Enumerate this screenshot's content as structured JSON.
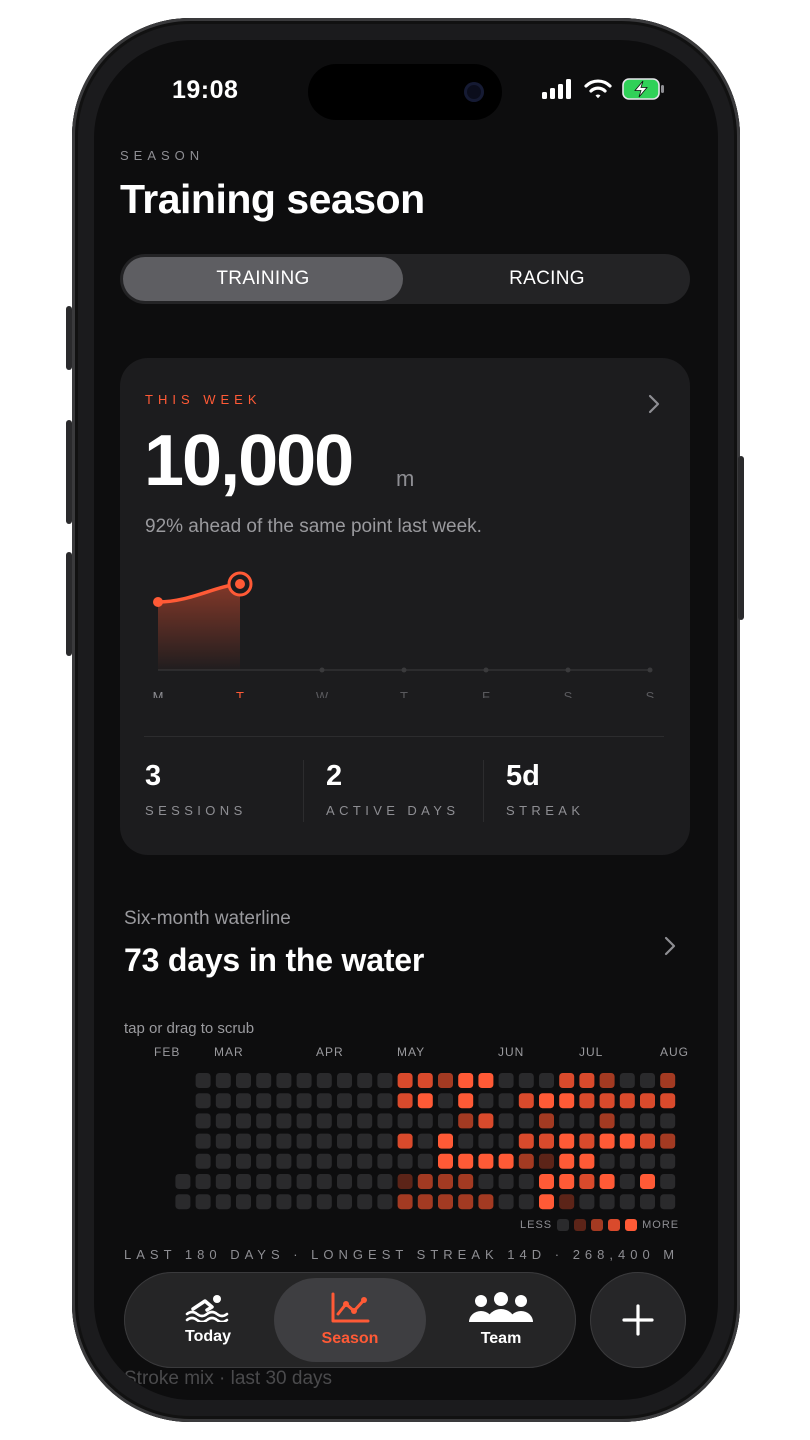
{
  "status": {
    "time": "19:08"
  },
  "header": {
    "eyebrow": "SEASON",
    "title": "Training season"
  },
  "segmented": {
    "options": [
      "TRAINING",
      "RACING"
    ],
    "selected": "TRAINING"
  },
  "week_card": {
    "eyebrow": "THIS WEEK",
    "value": "10,000",
    "unit": "m",
    "comparison": "92% ahead of the same point last week.",
    "days": [
      "M",
      "T",
      "W",
      "T",
      "F",
      "S",
      "S"
    ],
    "today_index": 1,
    "stats": [
      {
        "value": "3",
        "label": "SESSIONS"
      },
      {
        "value": "2",
        "label": "ACTIVE DAYS"
      },
      {
        "value": "5d",
        "label": "STREAK"
      }
    ]
  },
  "waterline": {
    "subtitle": "Six-month waterline",
    "title": "73 days in the water",
    "scrub_hint": "tap or drag to scrub",
    "months": [
      "FEB",
      "MAR",
      "APR",
      "MAY",
      "JUN",
      "JUL",
      "AUG"
    ],
    "legend_less": "LESS",
    "legend_more": "MORE",
    "footer": "LAST 180 DAYS · LONGEST STREAK 14D · 268,400 M"
  },
  "next_section_title": "Stroke mix · last 30 days",
  "tabbar": {
    "tabs": [
      {
        "label": "Today",
        "icon": "swimmer-icon"
      },
      {
        "label": "Season",
        "icon": "chart-icon"
      },
      {
        "label": "Team",
        "icon": "team-icon"
      }
    ],
    "active": "Season",
    "fab_icon": "plus-icon"
  },
  "colors": {
    "accent": "#ff5a36",
    "heat_levels": [
      "#2a2a2c",
      "#5c2418",
      "#a33a22",
      "#d94a2c",
      "#ff5a36"
    ]
  }
}
